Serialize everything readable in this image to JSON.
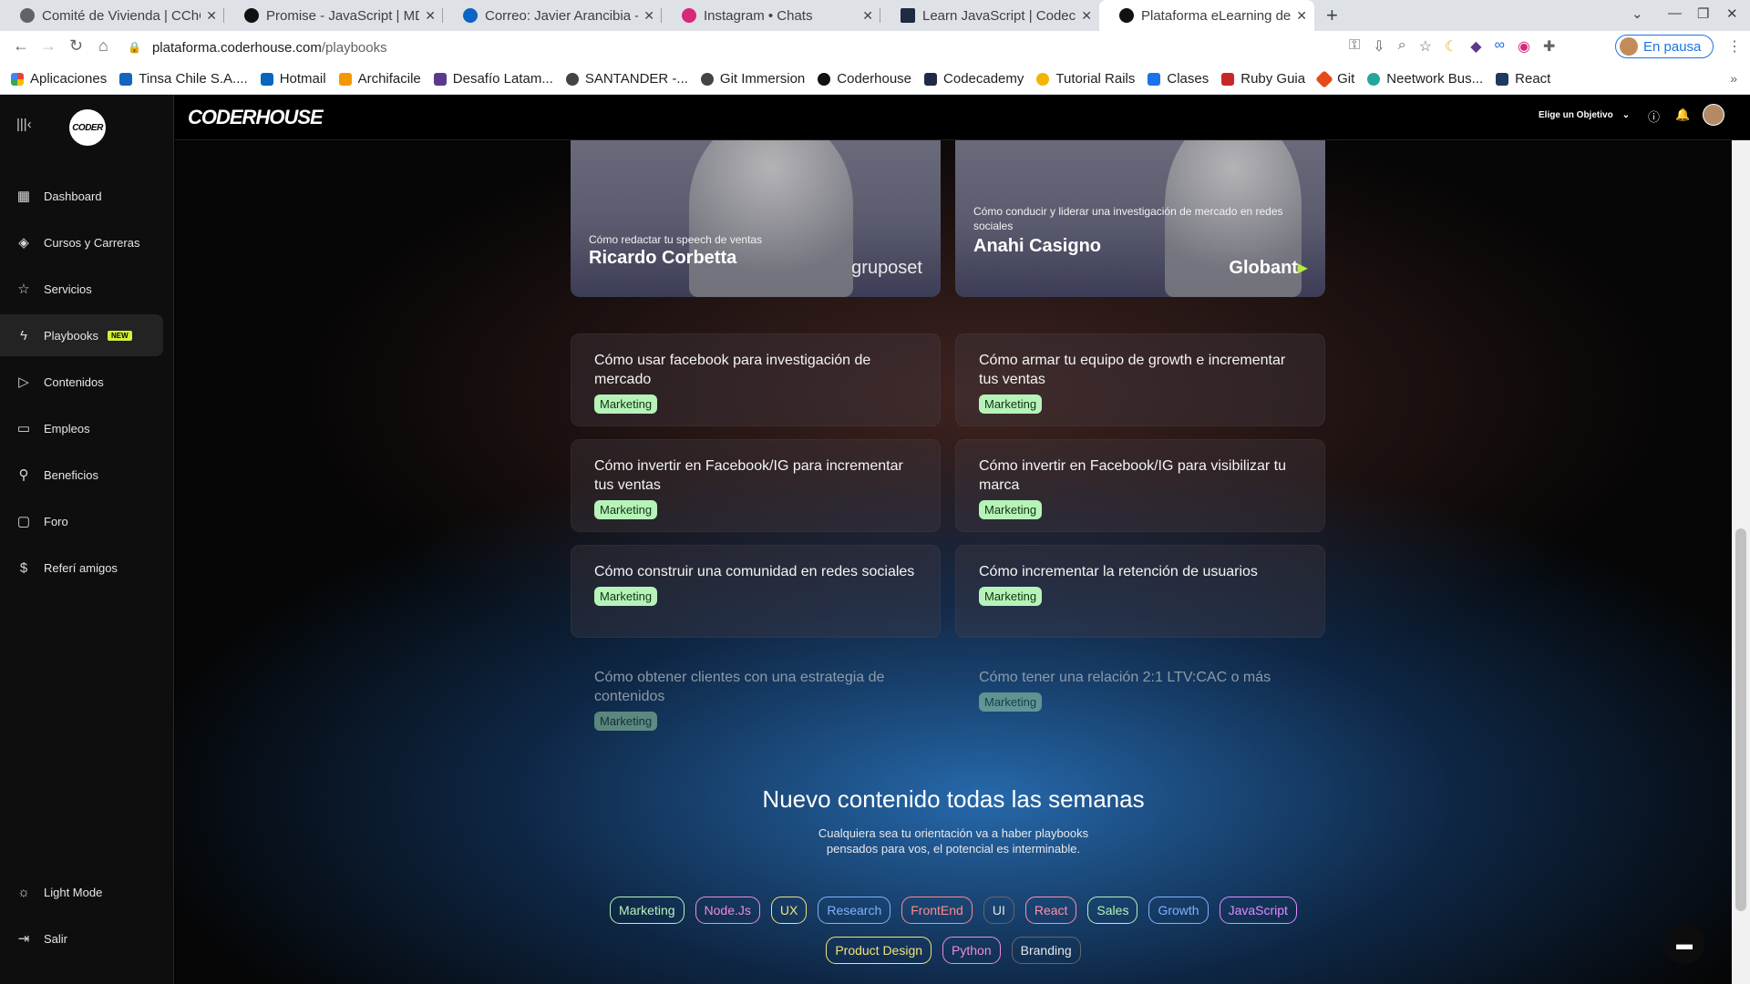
{
  "tabs": [
    {
      "title": "Comité de Vivienda | CChC",
      "fav": "#5f6368"
    },
    {
      "title": "Promise - JavaScript | MDN",
      "fav": "#111111"
    },
    {
      "title": "Correo: Javier Arancibia - Outlook",
      "fav": "#0a64c2"
    },
    {
      "title": "Instagram • Chats",
      "fav": "#d6297a"
    },
    {
      "title": "Learn JavaScript | Codecademy",
      "fav": "#1f2a44"
    },
    {
      "title": "Plataforma eLearning de Coderhouse",
      "fav": "#111111"
    }
  ],
  "url": {
    "domain": "plataforma.coderhouse.com",
    "path": "/playbooks"
  },
  "profile_label": "En pausa",
  "bookmarks": [
    {
      "label": "Aplicaciones",
      "color": "#e94235"
    },
    {
      "label": "Tinsa Chile S.A....",
      "color": "#1565c0"
    },
    {
      "label": "Hotmail",
      "color": "#0a64c2"
    },
    {
      "label": "Archifacile",
      "color": "#f29900"
    },
    {
      "label": "Desafío Latam...",
      "color": "#5b3a8c"
    },
    {
      "label": "SANTANDER -...",
      "color": "#444444"
    },
    {
      "label": "Git Immersion",
      "color": "#444444"
    },
    {
      "label": "Coderhouse",
      "color": "#111111"
    },
    {
      "label": "Codecademy",
      "color": "#1f2a44"
    },
    {
      "label": "Tutorial Rails",
      "color": "#f5b400"
    },
    {
      "label": "Clases",
      "color": "#1a73e8"
    },
    {
      "label": "Ruby Guia",
      "color": "#c62828"
    },
    {
      "label": "Git",
      "color": "#e64a19"
    },
    {
      "label": "Neetwork Bus...",
      "color": "#26a69a"
    },
    {
      "label": "React",
      "color": "#1e3a5f"
    }
  ],
  "sidebar": {
    "items": [
      {
        "label": "Dashboard",
        "icon": "grid-icon",
        "glyph": "▦"
      },
      {
        "label": "Cursos y Carreras",
        "icon": "graduation-icon",
        "glyph": "◈"
      },
      {
        "label": "Servicios",
        "icon": "star-icon",
        "glyph": "☆"
      },
      {
        "label": "Playbooks",
        "icon": "bolt-icon",
        "glyph": "ϟ",
        "badge": "NEW"
      },
      {
        "label": "Contenidos",
        "icon": "play-icon",
        "glyph": "▷"
      },
      {
        "label": "Empleos",
        "icon": "briefcase-icon",
        "glyph": "▭"
      },
      {
        "label": "Beneficios",
        "icon": "gift-icon",
        "glyph": "⚲"
      },
      {
        "label": "Foro",
        "icon": "chat-icon",
        "glyph": "▢"
      },
      {
        "label": "Referí amigos",
        "icon": "coin-icon",
        "glyph": "$"
      }
    ],
    "bottom": [
      {
        "label": "Light Mode",
        "icon": "sun-icon",
        "glyph": "☼"
      },
      {
        "label": "Salir",
        "icon": "logout-icon",
        "glyph": "⇥"
      }
    ],
    "logo_text": "CODER"
  },
  "topbar": {
    "brand": "CODERHOUSE",
    "goal_label": "Elige un Objetivo"
  },
  "heroes": [
    {
      "subtitle": "Cómo redactar tu speech de ventas",
      "name": "Ricardo Corbetta",
      "company": "gruposet"
    },
    {
      "subtitle": "Cómo conducir y liderar una investigación de mercado en redes sociales",
      "name": "Anahi Casigno",
      "company": "Globant"
    }
  ],
  "playbooks": [
    {
      "title": "Cómo usar facebook para investigación de mercado",
      "tag": "Marketing"
    },
    {
      "title": "Cómo armar tu equipo de growth e incrementar tus ventas",
      "tag": "Marketing"
    },
    {
      "title": "Cómo invertir en Facebook/IG para incrementar tus ventas",
      "tag": "Marketing"
    },
    {
      "title": "Cómo invertir en Facebook/IG para visibilizar tu marca",
      "tag": "Marketing"
    },
    {
      "title": "Cómo construir una comunidad en redes sociales",
      "tag": "Marketing"
    },
    {
      "title": "Cómo incrementar la retención de usuarios",
      "tag": "Marketing"
    },
    {
      "title": "Cómo obtener clientes con una estrategia de contenidos",
      "tag": "Marketing"
    },
    {
      "title": "Cómo tener una relación 2:1 LTV:CAC o más",
      "tag": "Marketing"
    }
  ],
  "promo": {
    "title": "Nuevo contenido todas las semanas",
    "line1": "Cualquiera sea tu orientación va a haber playbooks",
    "line2": "pensados para vos, el potencial es interminable."
  },
  "chips_row1": [
    {
      "label": "Marketing",
      "color": "#b6f3b8"
    },
    {
      "label": "Node.Js",
      "color": "#f08ad8"
    },
    {
      "label": "UX",
      "color": "#f3e27a"
    },
    {
      "label": "Research",
      "color": "#7fb2ff"
    },
    {
      "label": "FrontEnd",
      "color": "#ff8a8a"
    },
    {
      "label": "UI",
      "color": "#e6e6e6"
    },
    {
      "label": "React",
      "color": "#ff8fa8"
    },
    {
      "label": "Sales",
      "color": "#b6f3b8"
    },
    {
      "label": "Growth",
      "color": "#7fb2ff"
    },
    {
      "label": "JavaScript",
      "color": "#e58aff"
    }
  ],
  "chips_row2": [
    {
      "label": "Product Design",
      "color": "#f3e27a"
    },
    {
      "label": "Python",
      "color": "#f08ad8"
    },
    {
      "label": "Branding",
      "color": "#e6e6e6"
    }
  ]
}
